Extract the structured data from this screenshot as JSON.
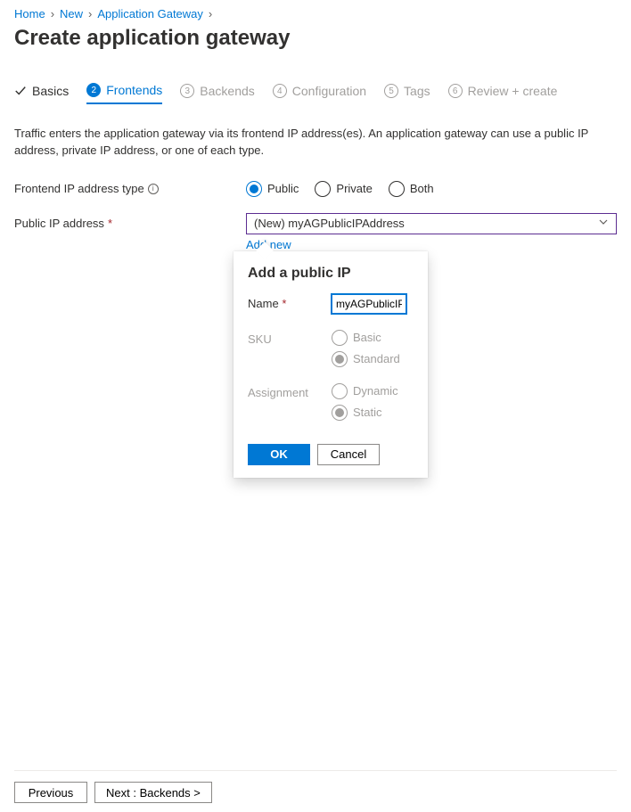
{
  "breadcrumb": [
    "Home",
    "New",
    "Application Gateway"
  ],
  "page_title": "Create application gateway",
  "tabs": {
    "basics": "Basics",
    "frontends": "Frontends",
    "backends": "Backends",
    "configuration": "Configuration",
    "tags": "Tags",
    "review": "Review + create"
  },
  "description": "Traffic enters the application gateway via its frontend IP address(es). An application gateway can use a public IP address, private IP address, or one of each type.",
  "form": {
    "frontend_ip_type_label": "Frontend IP address type",
    "frontend_ip_type_options": {
      "public": "Public",
      "private": "Private",
      "both": "Both"
    },
    "frontend_ip_type_value": "public",
    "public_ip_label": "Public IP address",
    "public_ip_value": "(New) myAGPublicIPAddress",
    "add_new_label": "Add new"
  },
  "popover": {
    "title": "Add a public IP",
    "name_label": "Name",
    "name_value": "myAGPublicIPAddress",
    "sku_label": "SKU",
    "sku_options": {
      "basic": "Basic",
      "standard": "Standard"
    },
    "sku_value": "standard",
    "assignment_label": "Assignment",
    "assignment_options": {
      "dynamic": "Dynamic",
      "static": "Static"
    },
    "assignment_value": "static",
    "ok_label": "OK",
    "cancel_label": "Cancel"
  },
  "footer": {
    "previous": "Previous",
    "next": "Next : Backends >"
  }
}
